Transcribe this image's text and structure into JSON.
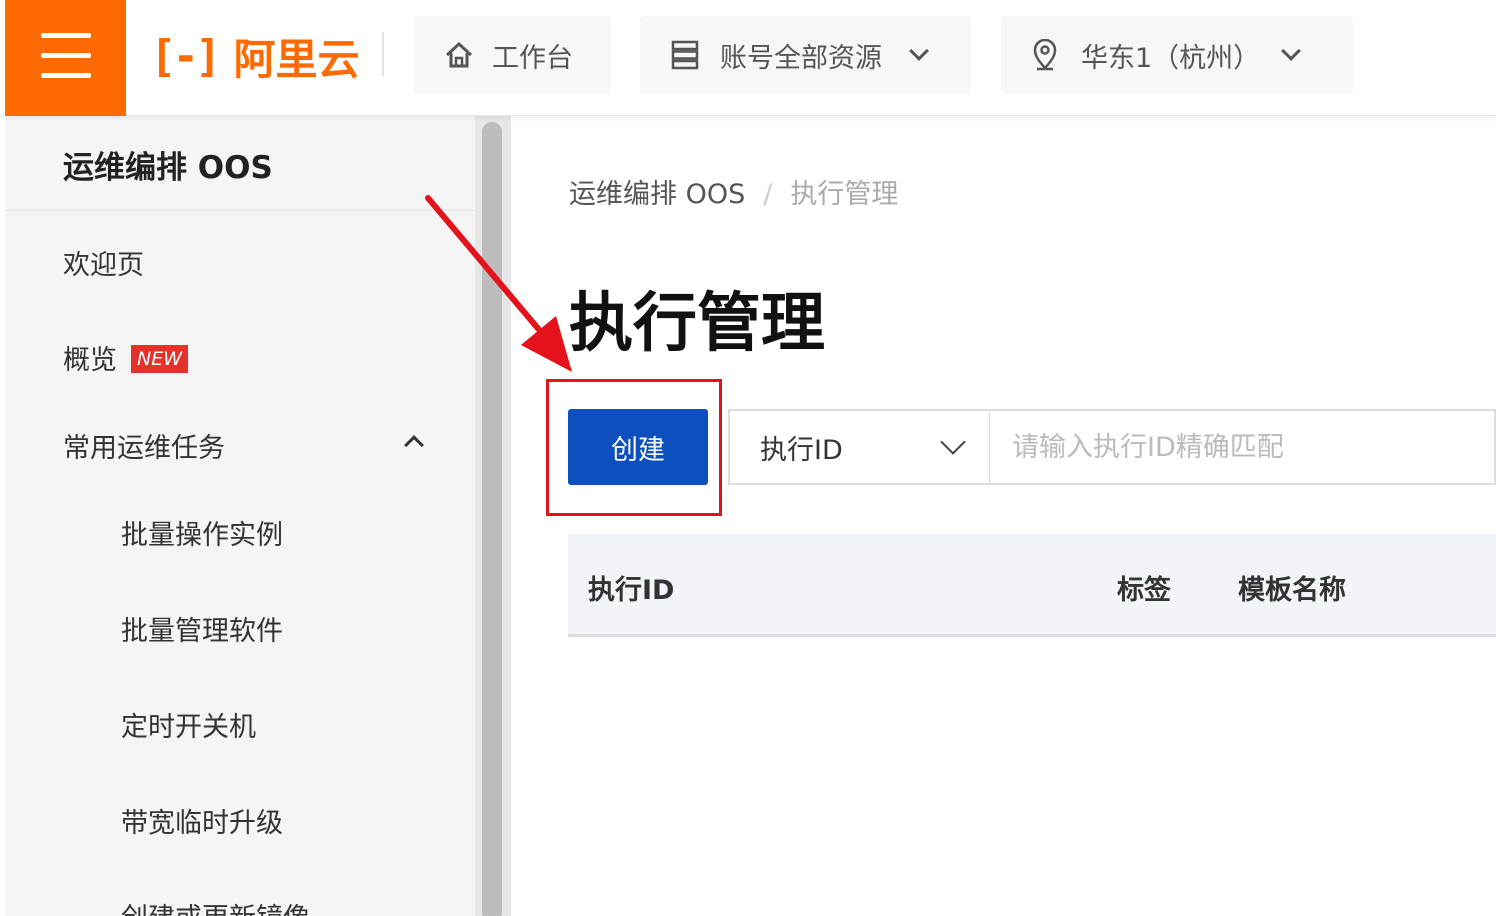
{
  "header": {
    "menu_icon": "hamburger-icon",
    "logo_mark": "[-]",
    "logo_text": "阿里云",
    "nav": {
      "workbench": {
        "icon": "home-icon",
        "label": "工作台"
      },
      "resources": {
        "icon": "server-icon",
        "label": "账号全部资源"
      },
      "region": {
        "icon": "location-pin-icon",
        "label": "华东1（杭州）"
      }
    }
  },
  "sidebar": {
    "title": "运维编排 OOS",
    "items": {
      "welcome": "欢迎页",
      "overview": "概览",
      "overview_badge": "NEW",
      "common_tasks": "常用运维任务",
      "batch_instances": "批量操作实例",
      "batch_software": "批量管理软件",
      "scheduled_power": "定时开关机",
      "bandwidth_upgrade": "带宽临时升级",
      "image_update": "创建或更新镜像"
    }
  },
  "breadcrumb": {
    "root": "运维编排 OOS",
    "separator": "/",
    "current": "执行管理"
  },
  "page": {
    "title": "执行管理",
    "create_button": "创建",
    "filter_field": "执行ID",
    "search_placeholder": "请输入执行ID精确匹配"
  },
  "table": {
    "columns": {
      "execution_id": "执行ID",
      "tags": "标签",
      "template_name": "模板名称"
    }
  },
  "colors": {
    "brand_orange": "#ff6a00",
    "primary_blue": "#0e4fbf",
    "annotation_red": "#e4121a"
  }
}
